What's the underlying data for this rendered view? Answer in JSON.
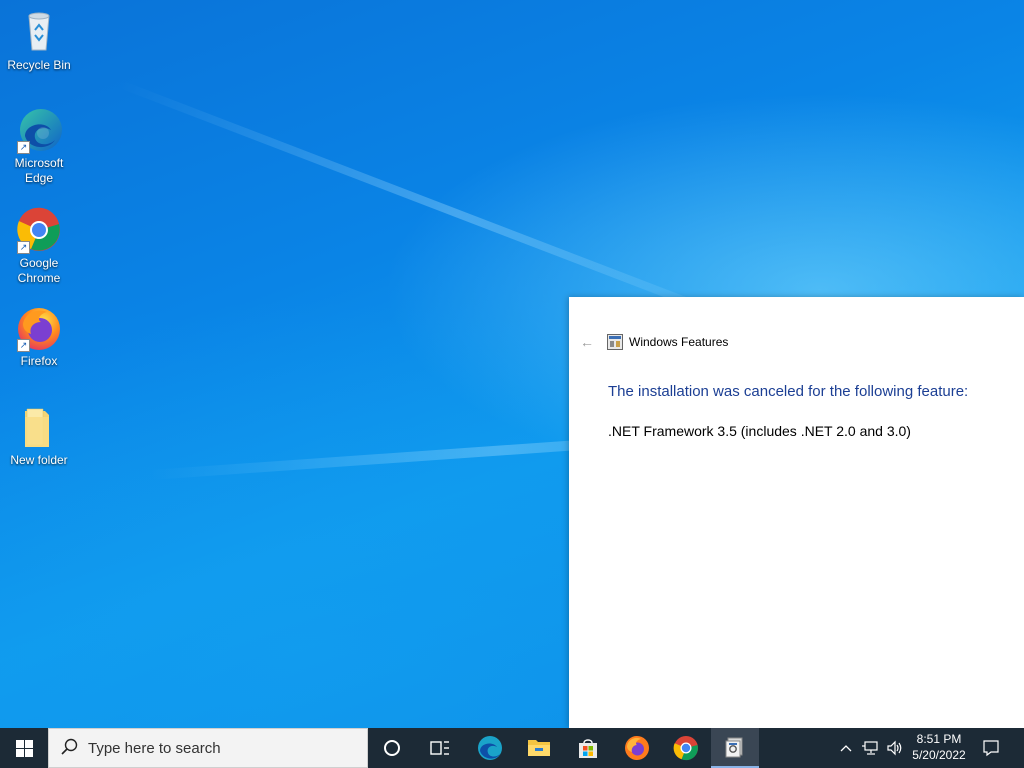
{
  "desktop": {
    "icons": [
      {
        "label": "Recycle Bin",
        "icon": "recycle-bin-icon"
      },
      {
        "label": "Microsoft Edge",
        "icon": "edge-icon"
      },
      {
        "label": "Google Chrome",
        "icon": "chrome-icon"
      },
      {
        "label": "Firefox",
        "icon": "firefox-icon"
      },
      {
        "label": "New folder",
        "icon": "folder-icon"
      }
    ]
  },
  "dialog": {
    "title": "Windows Features",
    "heading": "The installation was canceled for the following feature:",
    "feature": ".NET Framework 3.5 (includes .NET 2.0 and 3.0)",
    "back_icon": "back-arrow-icon",
    "heading_color": "#1c3f94"
  },
  "taskbar": {
    "search_placeholder": "Type here to search",
    "pinned": [
      "cortana",
      "task-view",
      "edge",
      "file-explorer",
      "microsoft-store",
      "firefox",
      "chrome",
      "windows-features"
    ],
    "active": "windows-features",
    "clock": {
      "time": "8:51 PM",
      "date": "5/20/2022"
    },
    "background": "#1c2a36"
  }
}
